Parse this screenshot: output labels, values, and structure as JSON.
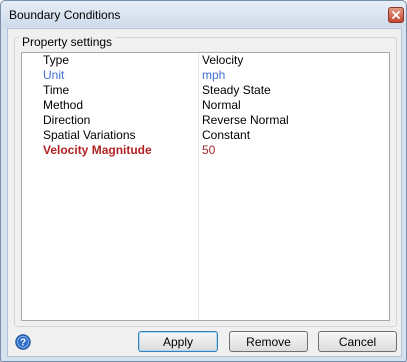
{
  "window": {
    "title": "Boundary Conditions"
  },
  "group": {
    "label": "Property settings"
  },
  "properties": [
    {
      "name": "Type",
      "value": "Velocity",
      "style": "normal"
    },
    {
      "name": "Unit",
      "value": "mph",
      "style": "link"
    },
    {
      "name": "Time",
      "value": "Steady State",
      "style": "normal"
    },
    {
      "name": "Method",
      "value": "Normal",
      "style": "normal"
    },
    {
      "name": "Direction",
      "value": "Reverse Normal",
      "style": "normal"
    },
    {
      "name": "Spatial Variations",
      "value": "Constant",
      "style": "normal"
    },
    {
      "name": "Velocity Magnitude",
      "value": "50",
      "style": "required"
    }
  ],
  "buttons": {
    "apply": "Apply",
    "remove": "Remove",
    "cancel": "Cancel"
  },
  "icons": {
    "close": "close-icon",
    "help": "help-icon"
  },
  "colors": {
    "link": "#3f6fd1",
    "required": "#b22222",
    "required_value": "#a0282b"
  }
}
